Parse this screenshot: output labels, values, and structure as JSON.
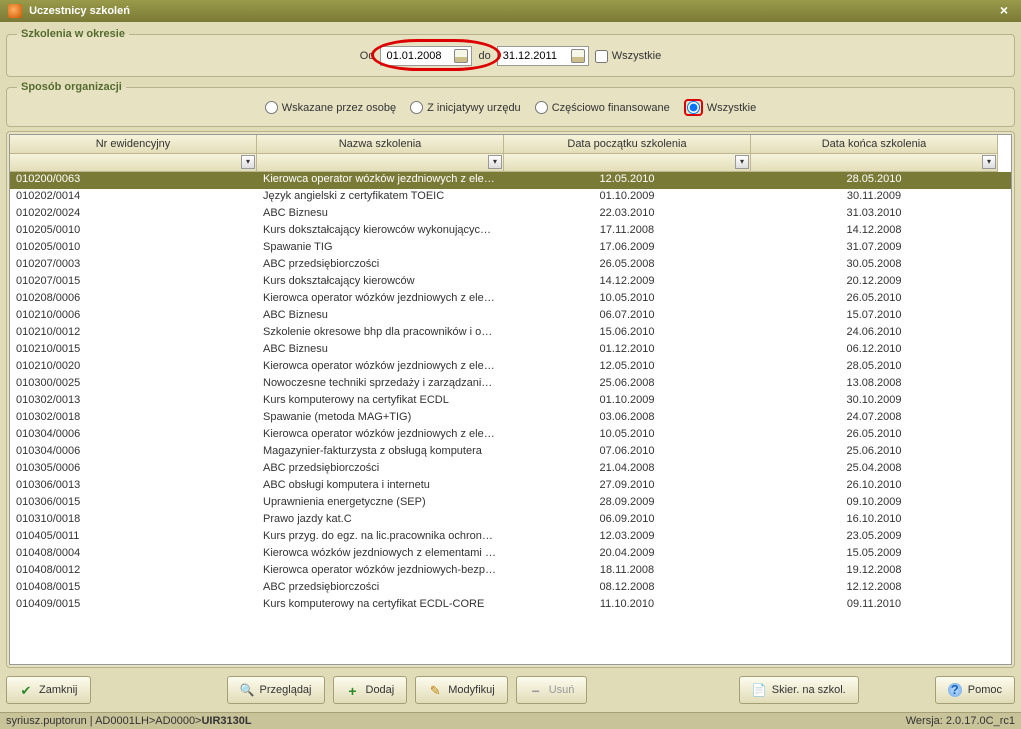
{
  "title": "Uczestnicy szkoleń",
  "fs_period": {
    "legend": "Szkolenia w okresie",
    "from_label": "Od",
    "from_value": "01.01.2008",
    "to_label": "do",
    "to_value": "31.12.2011",
    "all_label": "Wszystkie"
  },
  "fs_org": {
    "legend": "Sposób organizacji",
    "opt1": "Wskazane przez osobę",
    "opt2": "Z inicjatywy urzędu",
    "opt3": "Częściowo finansowane",
    "opt4": "Wszystkie"
  },
  "columns": {
    "id": "Nr ewidencyjny",
    "name": "Nazwa szkolenia",
    "start": "Data początku szkolenia",
    "end": "Data końca szkolenia"
  },
  "rows": [
    {
      "id": "010200/0063",
      "name": "Kierowca operator wózków jezdniowych z elem…",
      "start": "12.05.2010",
      "end": "28.05.2010",
      "selected": true
    },
    {
      "id": "010202/0014",
      "name": "Język angielski z certyfikatem TOEIC",
      "start": "01.10.2009",
      "end": "30.11.2009"
    },
    {
      "id": "010202/0024",
      "name": "ABC Biznesu",
      "start": "22.03.2010",
      "end": "31.03.2010"
    },
    {
      "id": "010205/0010",
      "name": "Kurs dokształcający kierowców wykonujących …",
      "start": "17.11.2008",
      "end": "14.12.2008"
    },
    {
      "id": "010205/0010",
      "name": "Spawanie TIG",
      "start": "17.06.2009",
      "end": "31.07.2009"
    },
    {
      "id": "010207/0003",
      "name": "ABC przedsiębiorczości",
      "start": "26.05.2008",
      "end": "30.05.2008"
    },
    {
      "id": "010207/0015",
      "name": "Kurs dokształcający kierowców",
      "start": "14.12.2009",
      "end": "20.12.2009"
    },
    {
      "id": "010208/0006",
      "name": "Kierowca operator wózków jezdniowych z elem…",
      "start": "10.05.2010",
      "end": "26.05.2010"
    },
    {
      "id": "010210/0006",
      "name": "ABC Biznesu",
      "start": "06.07.2010",
      "end": "15.07.2010"
    },
    {
      "id": "010210/0012",
      "name": "Szkolenie okresowe bhp dla pracowników i osó…",
      "start": "15.06.2010",
      "end": "24.06.2010"
    },
    {
      "id": "010210/0015",
      "name": "ABC Biznesu",
      "start": "01.12.2010",
      "end": "06.12.2010"
    },
    {
      "id": "010210/0020",
      "name": "Kierowca operator wózków jezdniowych z elem…",
      "start": "12.05.2010",
      "end": "28.05.2010"
    },
    {
      "id": "010300/0025",
      "name": "Nowoczesne techniki sprzedaży i zarządzanie s…",
      "start": "25.06.2008",
      "end": "13.08.2008"
    },
    {
      "id": "010302/0013",
      "name": "Kurs komputerowy na certyfikat ECDL",
      "start": "01.10.2009",
      "end": "30.10.2009"
    },
    {
      "id": "010302/0018",
      "name": "Spawanie (metoda MAG+TIG)",
      "start": "03.06.2008",
      "end": "24.07.2008"
    },
    {
      "id": "010304/0006",
      "name": "Kierowca operator wózków jezdniowych z elem…",
      "start": "10.05.2010",
      "end": "26.05.2010"
    },
    {
      "id": "010304/0006",
      "name": "Magazynier-fakturzysta z obsługą komputera",
      "start": "07.06.2010",
      "end": "25.06.2010"
    },
    {
      "id": "010305/0006",
      "name": "ABC przedsiębiorczości",
      "start": "21.04.2008",
      "end": "25.04.2008"
    },
    {
      "id": "010306/0013",
      "name": "ABC obsługi komputera i internetu",
      "start": "27.09.2010",
      "end": "26.10.2010"
    },
    {
      "id": "010306/0015",
      "name": "Uprawnienia energetyczne (SEP)",
      "start": "28.09.2009",
      "end": "09.10.2009"
    },
    {
      "id": "010310/0018",
      "name": "Prawo jazdy kat.C",
      "start": "06.09.2010",
      "end": "16.10.2010"
    },
    {
      "id": "010405/0011",
      "name": "Kurs przyg. do egz. na lic.pracownika ochrony …",
      "start": "12.03.2009",
      "end": "23.05.2009"
    },
    {
      "id": "010408/0004",
      "name": "Kierowca wózków jezdniowych z elementami g…",
      "start": "20.04.2009",
      "end": "15.05.2009"
    },
    {
      "id": "010408/0012",
      "name": "Kierowca operator wózków jezdniowych-bezpieczna wy…",
      "start": "18.11.2008",
      "end": "19.12.2008"
    },
    {
      "id": "010408/0015",
      "name": "ABC przedsiębiorczości",
      "start": "08.12.2008",
      "end": "12.12.2008"
    },
    {
      "id": "010409/0015",
      "name": "Kurs komputerowy na certyfikat ECDL-CORE",
      "start": "11.10.2010",
      "end": "09.11.2010"
    }
  ],
  "buttons": {
    "close": "Zamknij",
    "browse": "Przeglądaj",
    "add": "Dodaj",
    "modify": "Modyfikuj",
    "delete": "Usuń",
    "skier": "Skier. na szkol.",
    "help": "Pomoc"
  },
  "status": {
    "left_prefix": "syriusz.puptorun | AD0001LH>AD0000>",
    "left_bold": "UIR3130L",
    "right": "Wersja: 2.0.17.0C_rc1"
  }
}
